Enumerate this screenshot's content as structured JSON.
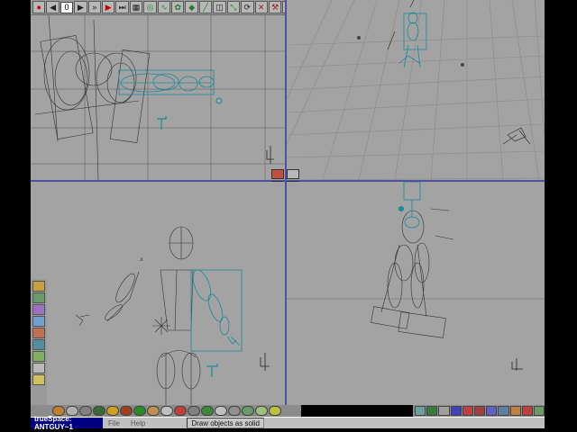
{
  "app": {
    "window_title": "trueSpace: ANTGUY~1"
  },
  "toolbar": {
    "frame_value": "0",
    "buttons": [
      "record-icon",
      "rewind-icon",
      "play-icon",
      "fast-forward-icon",
      "end-icon",
      "keyframe-icon",
      "object-icon",
      "path-icon",
      "animation-icon",
      "render-icon",
      "scale-icon",
      "rotate-icon",
      "move-icon",
      "link-icon",
      "home-icon",
      "down-icon"
    ]
  },
  "menu": {
    "file": "File",
    "help": "Help"
  },
  "status": {
    "message": "Draw objects as solid"
  },
  "colors": {
    "viewport_bg": "#a3a3a3",
    "wire": "#333333",
    "selected": "#1a8a9a",
    "divider": "#5050a0"
  }
}
